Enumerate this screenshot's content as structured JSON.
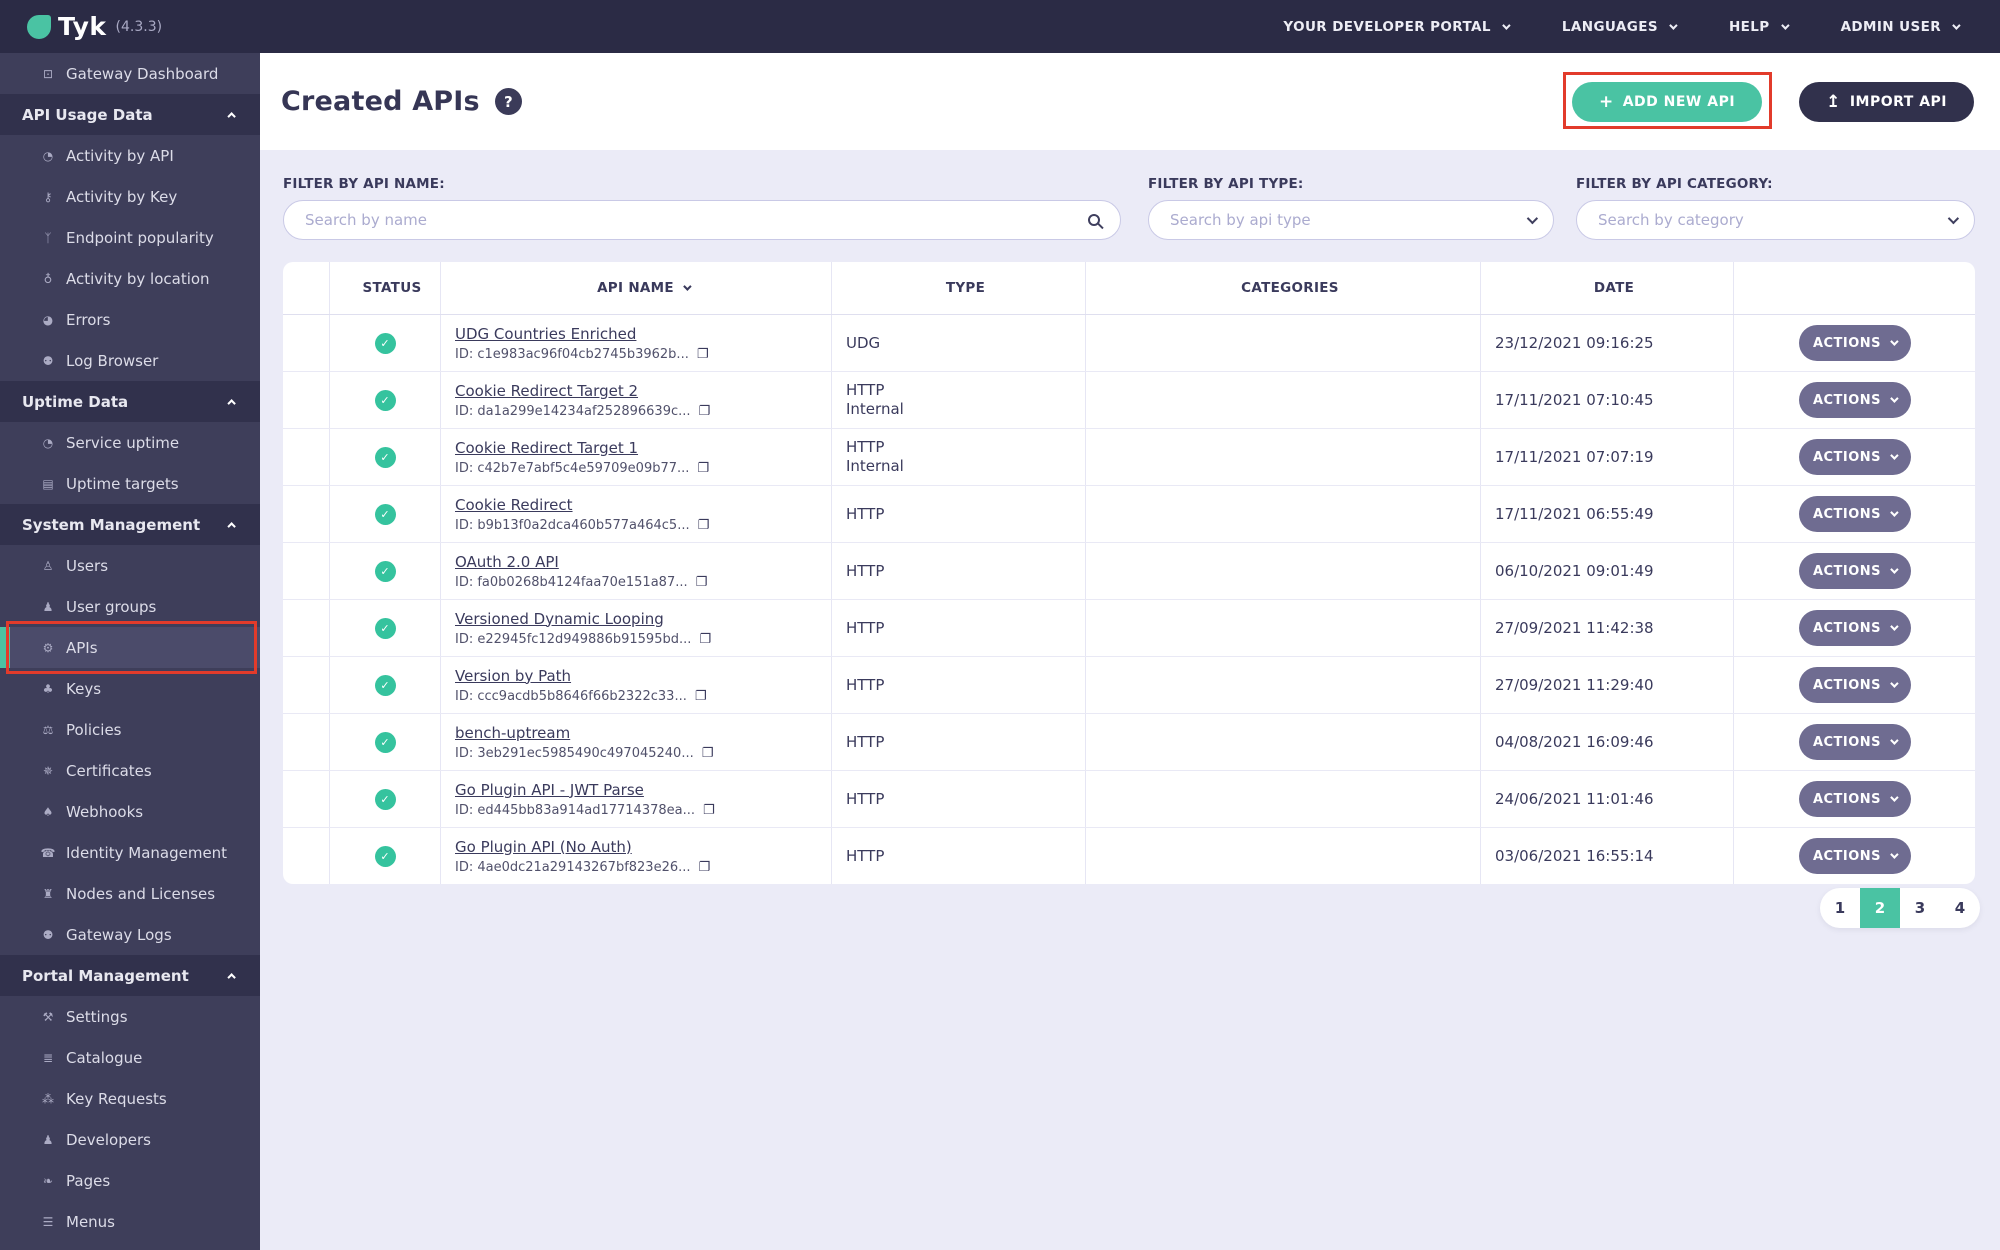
{
  "colors": {
    "accent_teal": "#4AC3A3",
    "annotation_red": "#E23B2B",
    "topbar_bg": "#2B2B45",
    "sidebar_bg": "#3E3E5A",
    "actions_btn": "#6F6C91",
    "filter_bg": "#EBEBF7"
  },
  "topbar": {
    "logo_text": "Tyk",
    "version": "(4.3.3)",
    "menu": [
      {
        "label": "YOUR DEVELOPER PORTAL",
        "icon": "chevron-down-icon"
      },
      {
        "label": "LANGUAGES",
        "icon": "chevron-down-icon"
      },
      {
        "label": "HELP",
        "icon": "chevron-down-icon"
      },
      {
        "label": "ADMIN USER",
        "icon": "chevron-down-icon"
      }
    ]
  },
  "sidebar": {
    "entries": [
      {
        "type": "item",
        "label": "Gateway Dashboard",
        "icon": "monitor-icon"
      },
      {
        "type": "header",
        "label": "API Usage Data",
        "icon": "chevron-up-icon"
      },
      {
        "type": "item",
        "label": "Activity by API",
        "icon": "pie-chart-icon"
      },
      {
        "type": "item",
        "label": "Activity by Key",
        "icon": "key-icon"
      },
      {
        "type": "item",
        "label": "Endpoint popularity",
        "icon": "branch-icon"
      },
      {
        "type": "item",
        "label": "Activity by location",
        "icon": "globe-icon"
      },
      {
        "type": "item",
        "label": "Errors",
        "icon": "pie-errors-icon"
      },
      {
        "type": "item",
        "label": "Log Browser",
        "icon": "bug-icon"
      },
      {
        "type": "header",
        "label": "Uptime Data",
        "icon": "chevron-up-icon"
      },
      {
        "type": "item",
        "label": "Service uptime",
        "icon": "pie-chart-icon"
      },
      {
        "type": "item",
        "label": "Uptime targets",
        "icon": "table-icon"
      },
      {
        "type": "header",
        "label": "System Management",
        "icon": "chevron-up-icon"
      },
      {
        "type": "item",
        "label": "Users",
        "icon": "user-icon"
      },
      {
        "type": "item",
        "label": "User groups",
        "icon": "user-group-icon"
      },
      {
        "type": "item",
        "label": "APIs",
        "icon": "cogs-icon",
        "active": true,
        "annotated": true
      },
      {
        "type": "item",
        "label": "Keys",
        "icon": "sitemap-icon"
      },
      {
        "type": "item",
        "label": "Policies",
        "icon": "policy-icon"
      },
      {
        "type": "item",
        "label": "Certificates",
        "icon": "certificate-icon"
      },
      {
        "type": "item",
        "label": "Webhooks",
        "icon": "bell-icon"
      },
      {
        "type": "item",
        "label": "Identity Management",
        "icon": "identity-icon"
      },
      {
        "type": "item",
        "label": "Nodes and Licenses",
        "icon": "bank-icon"
      },
      {
        "type": "item",
        "label": "Gateway Logs",
        "icon": "bug-icon"
      },
      {
        "type": "header",
        "label": "Portal Management",
        "icon": "chevron-up-icon"
      },
      {
        "type": "item",
        "label": "Settings",
        "icon": "wrench-icon"
      },
      {
        "type": "item",
        "label": "Catalogue",
        "icon": "catalogue-icon"
      },
      {
        "type": "item",
        "label": "Key Requests",
        "icon": "paw-icon"
      },
      {
        "type": "item",
        "label": "Developers",
        "icon": "user-group-icon"
      },
      {
        "type": "item",
        "label": "Pages",
        "icon": "leaf-icon"
      },
      {
        "type": "item",
        "label": "Menus",
        "icon": "bars-icon"
      }
    ]
  },
  "page": {
    "title": "Created APIs",
    "help_icon_label": "?",
    "add_button": "ADD NEW API",
    "add_button_icon": "plus-icon",
    "import_button": "IMPORT API",
    "import_button_icon": "upload-icon"
  },
  "filters": {
    "name": {
      "label": "FILTER BY API NAME:",
      "placeholder": "Search by name",
      "icon": "search-icon"
    },
    "type": {
      "label": "FILTER BY API TYPE:",
      "placeholder": "Search by api type",
      "icon": "chevron-down-icon"
    },
    "category": {
      "label": "FILTER BY API CATEGORY:",
      "placeholder": "Search by category",
      "icon": "chevron-down-icon"
    }
  },
  "table": {
    "columns": {
      "status": "STATUS",
      "name": "API NAME",
      "type": "TYPE",
      "categories": "CATEGORIES",
      "date": "DATE"
    },
    "sort_icon": "chevron-down-icon",
    "status_icon": "check-icon",
    "copy_icon": "copy-icon",
    "actions_label": "ACTIONS",
    "rows": [
      {
        "status": "active",
        "name": "UDG Countries Enriched",
        "id": "ID: c1e983ac96f04cb2745b3962b...",
        "type": [
          "UDG"
        ],
        "categories": "",
        "date": "23/12/2021 09:16:25"
      },
      {
        "status": "active",
        "name": "Cookie Redirect Target 2",
        "id": "ID: da1a299e14234af252896639c...",
        "type": [
          "HTTP",
          "Internal"
        ],
        "categories": "",
        "date": "17/11/2021 07:10:45"
      },
      {
        "status": "active",
        "name": "Cookie Redirect Target 1",
        "id": "ID: c42b7e7abf5c4e59709e09b77...",
        "type": [
          "HTTP",
          "Internal"
        ],
        "categories": "",
        "date": "17/11/2021 07:07:19"
      },
      {
        "status": "active",
        "name": "Cookie Redirect",
        "id": "ID: b9b13f0a2dca460b577a464c5...",
        "type": [
          "HTTP"
        ],
        "categories": "",
        "date": "17/11/2021 06:55:49"
      },
      {
        "status": "active",
        "name": "OAuth 2.0 API",
        "id": "ID: fa0b0268b4124faa70e151a87...",
        "type": [
          "HTTP"
        ],
        "categories": "",
        "date": "06/10/2021 09:01:49"
      },
      {
        "status": "active",
        "name": "Versioned Dynamic Looping",
        "id": "ID: e22945fc12d949886b91595bd...",
        "type": [
          "HTTP"
        ],
        "categories": "",
        "date": "27/09/2021 11:42:38"
      },
      {
        "status": "active",
        "name": "Version by Path",
        "id": "ID: ccc9acdb5b8646f66b2322c33...",
        "type": [
          "HTTP"
        ],
        "categories": "",
        "date": "27/09/2021 11:29:40"
      },
      {
        "status": "active",
        "name": "bench-uptream",
        "id": "ID: 3eb291ec5985490c497045240...",
        "type": [
          "HTTP"
        ],
        "categories": "",
        "date": "04/08/2021 16:09:46"
      },
      {
        "status": "active",
        "name": "Go Plugin API - JWT Parse",
        "id": "ID: ed445bb83a914ad17714378ea...",
        "type": [
          "HTTP"
        ],
        "categories": "",
        "date": "24/06/2021 11:01:46"
      },
      {
        "status": "active",
        "name": "Go Plugin API (No Auth)",
        "id": "ID: 4ae0dc21a29143267bf823e26...",
        "type": [
          "HTTP"
        ],
        "categories": "",
        "date": "03/06/2021 16:55:14"
      }
    ]
  },
  "pagination": {
    "pages": [
      "1",
      "2",
      "3",
      "4"
    ],
    "active": "2"
  }
}
